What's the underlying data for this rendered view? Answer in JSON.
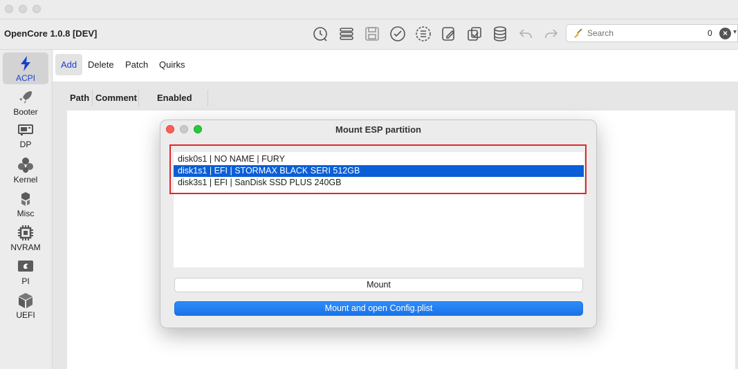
{
  "window": {
    "app_title": "OpenCore 1.0.8 [DEV]"
  },
  "toolbar": {
    "icons": [
      "history-icon",
      "list-icon",
      "save-icon",
      "checkmark-icon",
      "tree-list-icon",
      "edit-icon",
      "copy-icon",
      "database-icon",
      "undo-icon",
      "redo-icon"
    ]
  },
  "search": {
    "placeholder": "Search",
    "count": "0"
  },
  "sidebar": {
    "items": [
      {
        "label": "ACPI",
        "icon": "acpi-icon",
        "active": true
      },
      {
        "label": "Booter",
        "icon": "rocket-icon"
      },
      {
        "label": "DP",
        "icon": "gpu-card-icon"
      },
      {
        "label": "Kernel",
        "icon": "kernel-icon"
      },
      {
        "label": "Misc",
        "icon": "misc-icon"
      },
      {
        "label": "NVRAM",
        "icon": "chip-icon"
      },
      {
        "label": "PI",
        "icon": "apple-icon"
      },
      {
        "label": "UEFI",
        "icon": "cube-icon"
      }
    ]
  },
  "tabs": [
    {
      "label": "Add",
      "active": true
    },
    {
      "label": "Delete"
    },
    {
      "label": "Patch"
    },
    {
      "label": "Quirks"
    }
  ],
  "table": {
    "columns": [
      "Path",
      "Comment",
      "Enabled"
    ]
  },
  "dialog": {
    "title": "Mount ESP partition",
    "partitions": [
      {
        "label": "disk0s1 | NO NAME | FURY",
        "selected": false
      },
      {
        "label": "disk1s1 | EFI | STORMAX BLACK SERI 512GB",
        "selected": true
      },
      {
        "label": "disk3s1 | EFI | SanDisk SSD PLUS 240GB",
        "selected": false
      }
    ],
    "mount_label": "Mount",
    "mount_open_label": "Mount and open Config.plist"
  },
  "colors": {
    "accent": "#1a3fcf",
    "selection": "#0a5fd6",
    "highlight": "#e0262b"
  }
}
